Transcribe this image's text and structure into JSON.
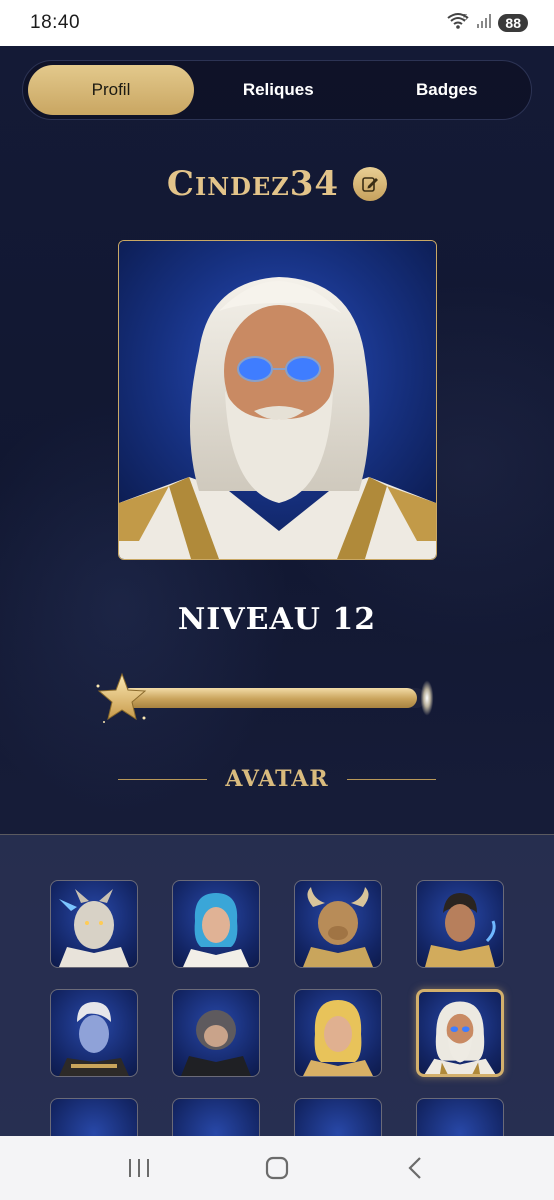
{
  "status_bar": {
    "time": "18:40",
    "battery": "88",
    "wifi_label": "5"
  },
  "tabs": [
    {
      "label": "Profil",
      "active": true
    },
    {
      "label": "Reliques",
      "active": false
    },
    {
      "label": "Badges",
      "active": false
    }
  ],
  "profile": {
    "username": "Cindez34",
    "level_label": "NIVEAU 12",
    "xp_fraction": 0.97
  },
  "avatar_section": {
    "title": "AVATAR",
    "avatars": [
      {
        "name": "white-dragon-warrior",
        "selected": false
      },
      {
        "name": "blue-haired-mage",
        "selected": false
      },
      {
        "name": "horned-minotaur",
        "selected": false
      },
      {
        "name": "dark-haired-paladin",
        "selected": false
      },
      {
        "name": "white-haired-spirit",
        "selected": false
      },
      {
        "name": "monkey-warrior",
        "selected": false
      },
      {
        "name": "blond-hero",
        "selected": false
      },
      {
        "name": "old-sage",
        "selected": true
      }
    ]
  },
  "colors": {
    "accent_gold": "#e3c48a",
    "tab_active": "#d7b877",
    "background": "#121832"
  },
  "icons": {
    "edit": "edit-icon",
    "star": "star-icon",
    "nav_recents": "recents-icon",
    "nav_home": "home-icon",
    "nav_back": "back-icon"
  }
}
